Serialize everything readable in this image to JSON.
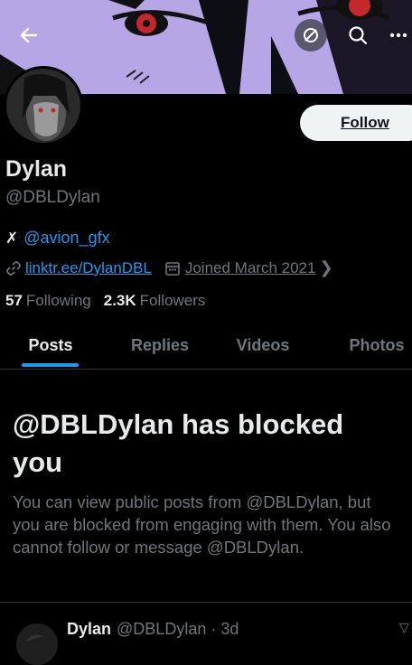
{
  "profile": {
    "name": "Dylan",
    "handle": "@DBLDylan",
    "affiliate": "@avion_gfx",
    "link": "linktr.ee/DylanDBL",
    "joined": "Joined March 2021",
    "following_count": "57",
    "following_label": "Following",
    "followers_count": "2.3K",
    "followers_label": "Followers"
  },
  "header": {
    "follow_label": "Follow",
    "icons": [
      "back-arrow-icon",
      "sync-icon",
      "search-icon",
      "more-icon"
    ]
  },
  "tabs": [
    {
      "label": "Posts",
      "active": true
    },
    {
      "label": "Replies",
      "active": false
    },
    {
      "label": "Videos",
      "active": false
    },
    {
      "label": "Photos",
      "active": false
    }
  ],
  "blocked": {
    "title": "@DBLDylan has blocked you",
    "description": "You can view public posts from @DBLDylan, but you are blocked from engaging with them. You also cannot follow or message @DBLDylan."
  },
  "post_preview": {
    "name": "Dylan",
    "meta": "@DBLDylan · 3d"
  },
  "colors": {
    "accent": "#1d9bf0",
    "banner": "#b7a6e6",
    "background": "#000000",
    "muted": "#71767b"
  }
}
